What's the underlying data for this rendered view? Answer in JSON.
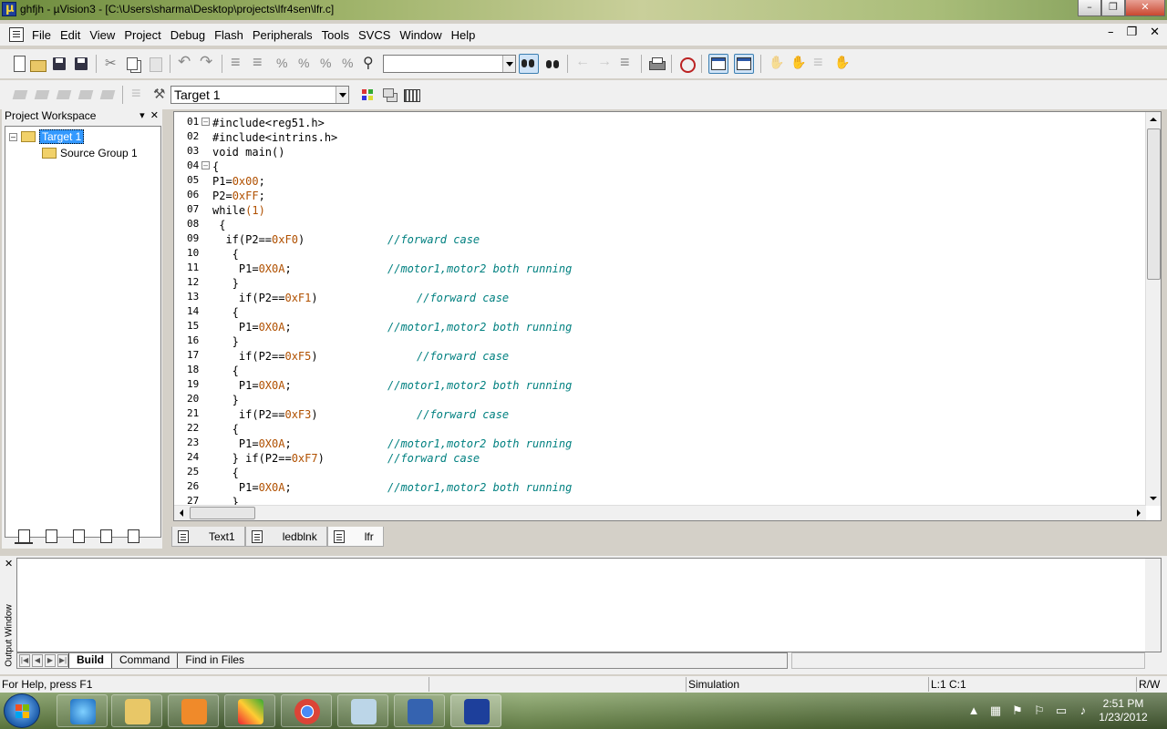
{
  "window": {
    "title": "ghfjh  - µVision3 - [C:\\Users\\sharma\\Desktop\\projects\\lfr4sen\\lfr.c]"
  },
  "menu": [
    "File",
    "Edit",
    "View",
    "Project",
    "Debug",
    "Flash",
    "Peripherals",
    "Tools",
    "SVCS",
    "Window",
    "Help"
  ],
  "toolbar": {
    "find_combo_value": "",
    "target_combo_value": "Target 1"
  },
  "workspace": {
    "title": "Project Workspace",
    "tree": [
      {
        "label": "Target 1",
        "selected": true
      },
      {
        "label": "Source Group 1",
        "selected": false
      }
    ]
  },
  "editor": {
    "lines": [
      {
        "n": "01",
        "code": "#include<reg51.h>",
        "comment": ""
      },
      {
        "n": "02",
        "code": "#include<intrins.h>",
        "comment": ""
      },
      {
        "n": "03",
        "code": "void main()",
        "comment": ""
      },
      {
        "n": "04",
        "code": "{",
        "comment": ""
      },
      {
        "n": "05",
        "code": "P1=0x00;",
        "comment": ""
      },
      {
        "n": "06",
        "code": "P2=0xFF;",
        "comment": ""
      },
      {
        "n": "07",
        "code": "while(1)",
        "comment": ""
      },
      {
        "n": "08",
        "code": " {",
        "comment": ""
      },
      {
        "n": "09",
        "code": "  if(P2==0xF0)",
        "comment": "//forward case"
      },
      {
        "n": "10",
        "code": "   {",
        "comment": ""
      },
      {
        "n": "11",
        "code": "    P1=0X0A;",
        "comment": "//motor1,motor2 both running"
      },
      {
        "n": "12",
        "code": "   }",
        "comment": ""
      },
      {
        "n": "13",
        "code": "    if(P2==0xF1)",
        "comment": "//forward case"
      },
      {
        "n": "14",
        "code": "   {",
        "comment": ""
      },
      {
        "n": "15",
        "code": "    P1=0X0A;",
        "comment": "//motor1,motor2 both running"
      },
      {
        "n": "16",
        "code": "   }",
        "comment": ""
      },
      {
        "n": "17",
        "code": "    if(P2==0xF5)",
        "comment": "//forward case"
      },
      {
        "n": "18",
        "code": "   {",
        "comment": ""
      },
      {
        "n": "19",
        "code": "    P1=0X0A;",
        "comment": "//motor1,motor2 both running"
      },
      {
        "n": "20",
        "code": "   }",
        "comment": ""
      },
      {
        "n": "21",
        "code": "    if(P2==0xF3)",
        "comment": "//forward case"
      },
      {
        "n": "22",
        "code": "   {",
        "comment": ""
      },
      {
        "n": "23",
        "code": "    P1=0X0A;",
        "comment": "//motor1,motor2 both running"
      },
      {
        "n": "24",
        "code": "   } if(P2==0xF7)",
        "comment": "//forward case"
      },
      {
        "n": "25",
        "code": "   {",
        "comment": ""
      },
      {
        "n": "26",
        "code": "    P1=0X0A;",
        "comment": "//motor1,motor2 both running"
      },
      {
        "n": "27",
        "code": "   }",
        "comment": ""
      }
    ]
  },
  "editor_tabs": [
    {
      "label": "Text1",
      "active": false
    },
    {
      "label": "ledblnk",
      "active": false
    },
    {
      "label": "lfr",
      "active": true
    }
  ],
  "output": {
    "side_label": "Output Window",
    "tabs": [
      {
        "label": "Build",
        "active": true
      },
      {
        "label": "Command",
        "active": false
      },
      {
        "label": "Find in Files",
        "active": false
      }
    ]
  },
  "status": {
    "help": "For Help, press F1",
    "mode": "Simulation",
    "position": "L:1 C:1",
    "rw": "R/W"
  },
  "taskbar": {
    "time": "2:51 PM",
    "date": "1/23/2012",
    "apps": [
      "internet-explorer",
      "windows-explorer",
      "media-player",
      "paint-tool",
      "chrome",
      "notepad-tool",
      "scope-tool",
      "uvision"
    ]
  }
}
